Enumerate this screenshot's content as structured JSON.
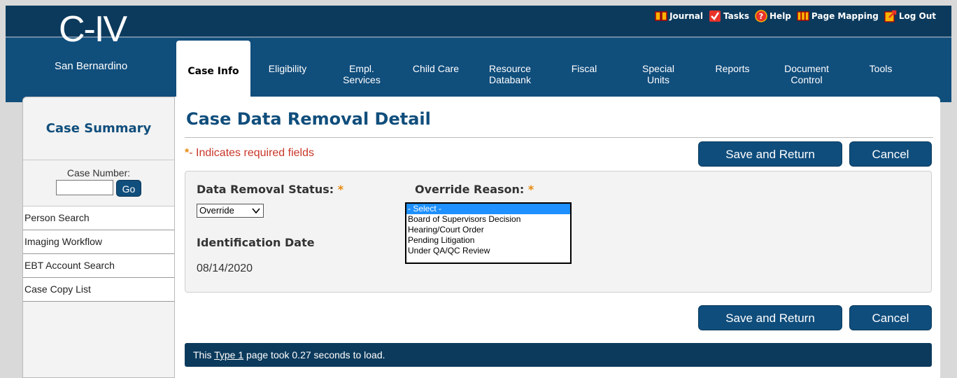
{
  "brand": {
    "logo": "C-IV",
    "site": "San Bernardino"
  },
  "util_links": [
    {
      "label": "Journal",
      "icon": "journal-icon"
    },
    {
      "label": "Tasks",
      "icon": "tasks-icon"
    },
    {
      "label": "Help",
      "icon": "help-icon"
    },
    {
      "label": "Page Mapping",
      "icon": "page-mapping-icon"
    },
    {
      "label": "Log Out",
      "icon": "logout-icon"
    }
  ],
  "tabs": [
    {
      "line1": "Case Info",
      "line2": ""
    },
    {
      "line1": "Eligibility",
      "line2": ""
    },
    {
      "line1": "Empl.",
      "line2": "Services"
    },
    {
      "line1": "Child Care",
      "line2": ""
    },
    {
      "line1": "Resource",
      "line2": "Databank"
    },
    {
      "line1": "Fiscal",
      "line2": ""
    },
    {
      "line1": "Special",
      "line2": "Units"
    },
    {
      "line1": "Reports",
      "line2": ""
    },
    {
      "line1": "Document",
      "line2": "Control"
    },
    {
      "line1": "Tools",
      "line2": ""
    }
  ],
  "sidebar": {
    "title": "Case Summary",
    "case_number_label": "Case Number:",
    "case_number_value": "",
    "go_label": "Go",
    "links": [
      "Person Search",
      "Imaging Workflow",
      "EBT Account Search",
      "Case Copy List"
    ]
  },
  "main": {
    "title": "Case Data Removal Detail",
    "required_star": "*",
    "required_note": "- Indicates required fields",
    "save_label": "Save and Return",
    "cancel_label": "Cancel",
    "status_label": "Data Removal Status:",
    "status_value": "Override",
    "override_label": "Override Reason:",
    "override_options": [
      "- Select -",
      "Board of Supervisors Decision",
      "Hearing/Court Order",
      "Pending Litigation",
      "Under QA/QC Review"
    ],
    "override_selected": "- Select -",
    "id_date_label": "Identification Date",
    "id_date_value": "08/14/2020",
    "footer_prefix": "This ",
    "footer_link": "Type 1",
    "footer_suffix": " page took 0.27 seconds to load."
  },
  "colors": {
    "header": "#104e7c",
    "topbar": "#0c3a5c",
    "accent": "#104e7c",
    "required": "#c8372a",
    "star": "#e8890b"
  }
}
